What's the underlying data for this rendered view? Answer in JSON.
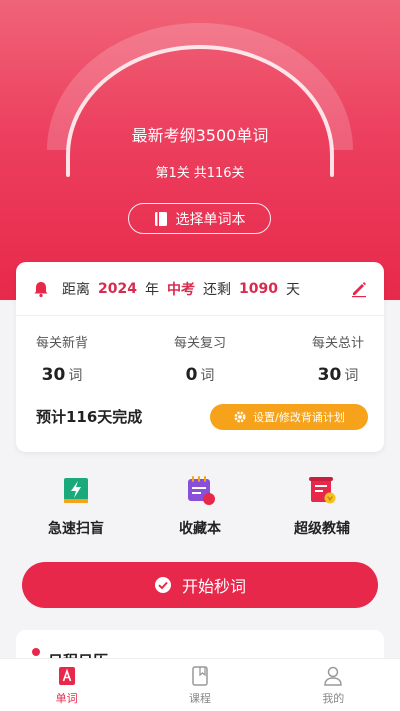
{
  "hero": {
    "title": "最新考纲3500单词",
    "level": "第1关",
    "total": "共116关",
    "select_button": "选择单词本"
  },
  "countdown": {
    "prefix": "距离",
    "year": "2024",
    "year_unit": "年",
    "exam": "中考",
    "remain": "还剩",
    "days": "1090",
    "days_unit": "天"
  },
  "stats": [
    {
      "label": "每关新背",
      "value": "30",
      "unit": "词"
    },
    {
      "label": "每关复习",
      "value": "0",
      "unit": "词"
    },
    {
      "label": "每关总计",
      "value": "30",
      "unit": "词"
    }
  ],
  "plan": {
    "eta": "预计116天完成",
    "button": "设置/修改背诵计划"
  },
  "tools": [
    {
      "label": "急速扫盲",
      "icon": "lightning-book-icon"
    },
    {
      "label": "收藏本",
      "icon": "calendar-badge-icon",
      "badge": "35"
    },
    {
      "label": "超级教辅",
      "icon": "scroll-medal-icon"
    }
  ],
  "start_button": "开始秒词",
  "bottom_card_title": "日程日历",
  "tabs": [
    {
      "label": "单词",
      "active": true
    },
    {
      "label": "课程",
      "active": false
    },
    {
      "label": "我的",
      "active": false
    }
  ],
  "colors": {
    "primary": "#e8284b",
    "accent_orange": "#f6a21b",
    "tool_green": "#1aa97a",
    "tool_purple": "#8a4fd8"
  }
}
